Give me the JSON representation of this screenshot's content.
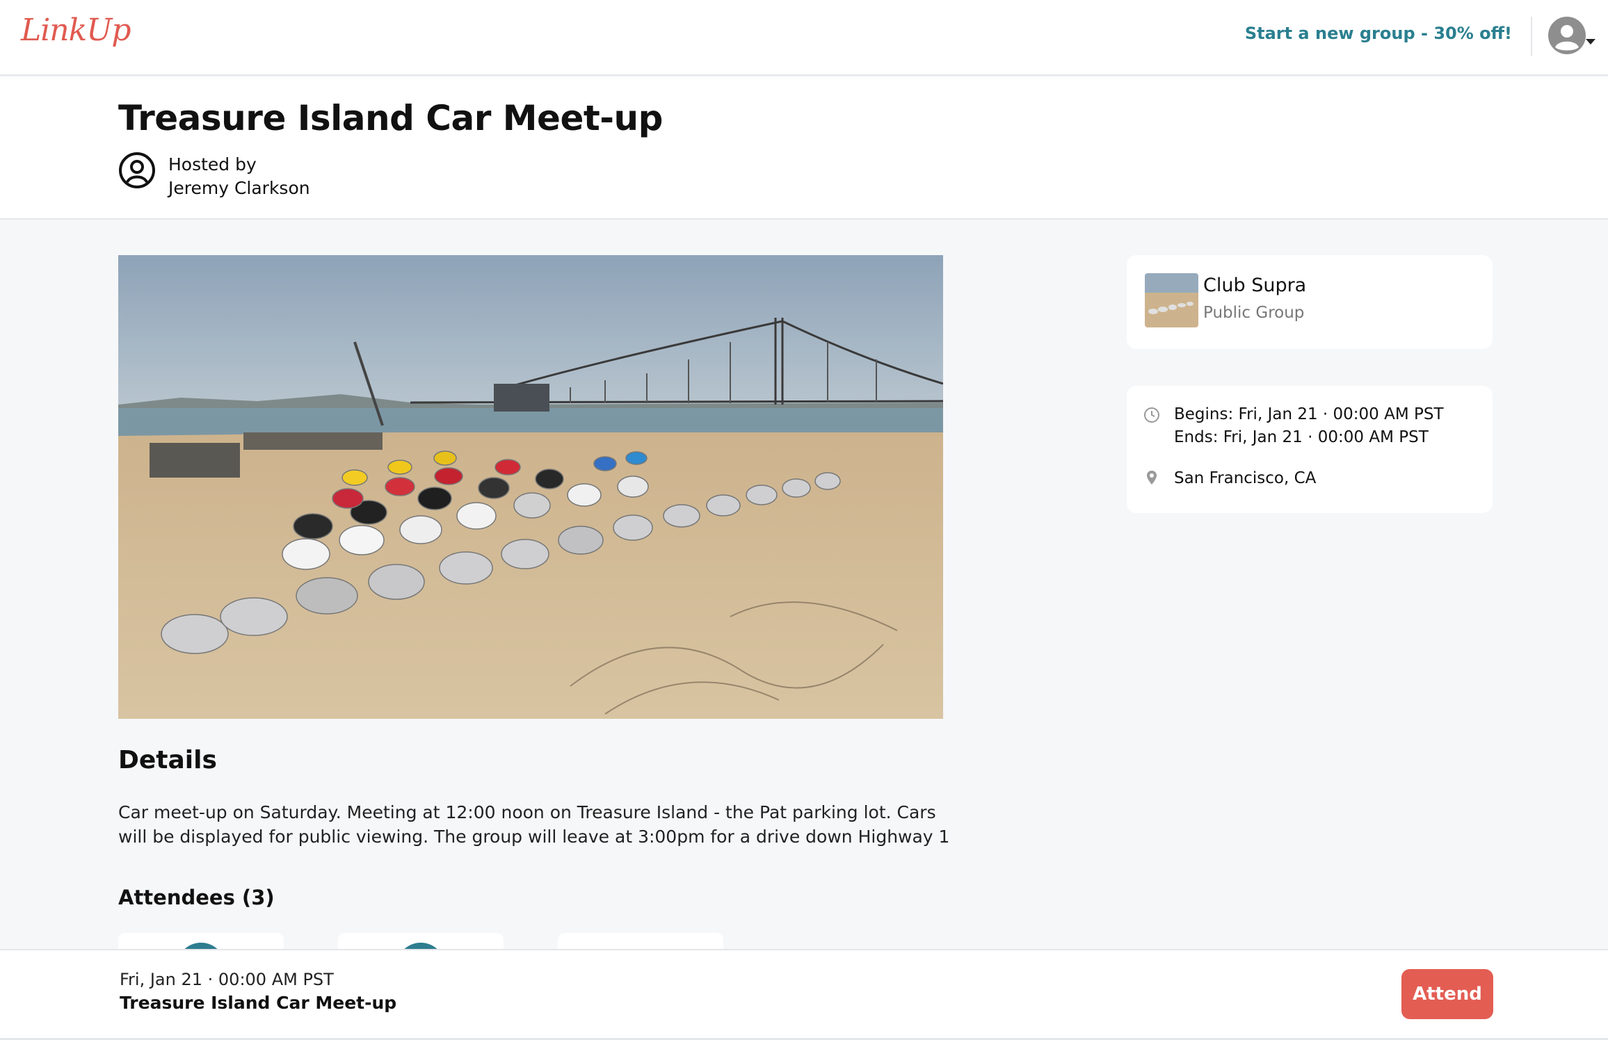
{
  "nav": {
    "logo_text": "LinkUp",
    "promo_link": "Start a new group - 30% off!",
    "avatar_icon": "user-avatar-icon",
    "menu_caret_icon": "caret-down-icon"
  },
  "event": {
    "title": "Treasure Island Car Meet-up",
    "hosted_by_label": "Hosted by",
    "host_name": "Jeremy Clarkson",
    "host_icon": "user-circle-icon",
    "image_description_icon": "event-photo"
  },
  "details": {
    "heading": "Details",
    "text": "Car meet-up on Saturday. Meeting at 12:00 noon on Treasure Island - the Pat parking lot. Cars will be displayed for public viewing. The group will leave at 3:00pm for a drive down Highway 1"
  },
  "attendees": {
    "heading": "Attendees (3)",
    "count": 3
  },
  "group": {
    "name": "Club Supra",
    "type": "Public Group"
  },
  "schedule": {
    "begins": "Begins: Fri, Jan 21 · 00:00 AM PST",
    "ends": "Ends: Fri, Jan 21 · 00:00 AM PST",
    "location": "San Francisco, CA",
    "clock_icon": "clock-icon",
    "location_icon": "map-pin-icon"
  },
  "footer": {
    "date": "Fri, Jan 21 · 00:00 AM PST",
    "title": "Treasure Island Car Meet-up",
    "attend_button": "Attend"
  },
  "colors": {
    "brand": "#e05a50",
    "link": "#2a7f8f",
    "attend_button": "#e35d53",
    "page_background": "#f6f7f9"
  }
}
